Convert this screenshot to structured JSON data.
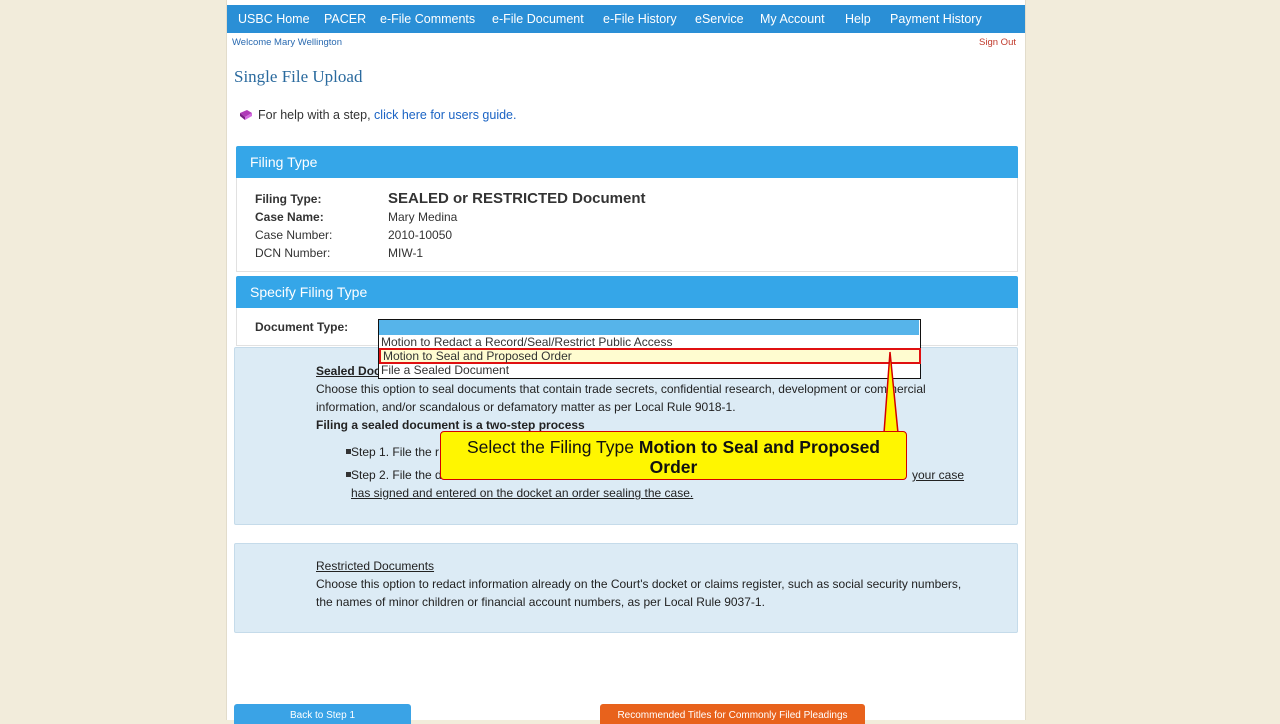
{
  "nav": {
    "items": [
      "USBC Home",
      "PACER",
      "e-File Comments",
      "e-File Document",
      "e-File History",
      "eService",
      "My Account",
      "Help",
      "Payment History"
    ]
  },
  "welcome": "Welcome Mary Wellington",
  "sign_out": "Sign Out",
  "page_title": "Single File Upload",
  "help": {
    "prefix": "For help with a step,",
    "link": "click here for users guide."
  },
  "filing_type_panel": {
    "heading": "Filing Type",
    "rows": [
      {
        "label": "Filing Type:",
        "value": "SEALED or RESTRICTED Document"
      },
      {
        "label": "Case Name:",
        "value": "Mary Medina"
      },
      {
        "label": "Case Number:",
        "value": "2010-10050"
      },
      {
        "label": "DCN Number:",
        "value": "MIW-1"
      }
    ]
  },
  "specify_panel": {
    "heading": "Specify Filing Type",
    "doc_type_label": "Document Type:",
    "dropdown": {
      "selected": "",
      "options": [
        "Motion to Redact a Record/Seal/Restrict Public Access",
        "Motion to Seal and Proposed Order",
        "File a Sealed Document"
      ],
      "highlighted_index": 1
    }
  },
  "sealed_box": {
    "heading": "Sealed Doc",
    "line1": "Choose this option to seal documents that contain trade secrets, confidential research, development or commercial",
    "line2": "information, and/or scandalous or defamatory matter as per Local Rule 9018-1.",
    "two_step": "Filing a sealed document is a two-step process",
    "step1": "Step 1. File the r",
    "step2_start": "Step 2. File the d",
    "step2_end": "your case",
    "step2_line2": "has signed and entered on the docket an order sealing the case."
  },
  "restricted_box": {
    "heading": "Restricted Documents",
    "line1": "Choose this option to redact information already on the Court's docket or claims register, such as social security numbers,",
    "line2": "the names of minor children or financial account numbers, as per Local Rule 9037-1."
  },
  "callout": {
    "text_plain": "Select the Filing Type",
    "text_bold": "Motion to Seal and Proposed Order"
  },
  "buttons": {
    "back": "Back to Step 1",
    "recommended": "Recommended Titles for Commonly Filed Pleadings"
  },
  "colors": {
    "nav_bg": "#2a8fd6",
    "panel_head": "#35a6e8",
    "info_bg": "#dcebf5",
    "callout_bg": "#fff600",
    "callout_border": "#d40000",
    "orange_button": "#e8621c",
    "blue_button": "#3aa3e6",
    "page_bg": "#f2ecdb"
  },
  "icons": {
    "help": "book-icon"
  }
}
